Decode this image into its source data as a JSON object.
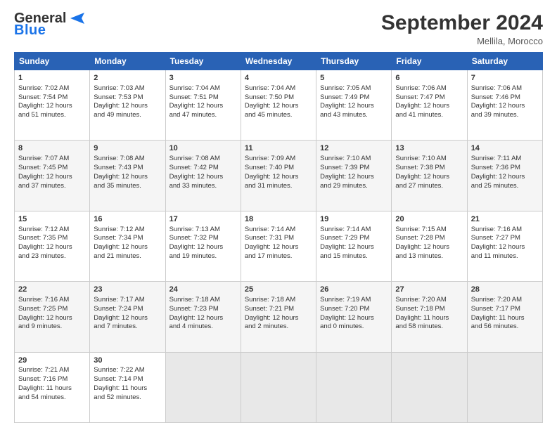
{
  "logo": {
    "line1": "General",
    "line2": "Blue"
  },
  "header": {
    "title": "September 2024",
    "location": "Mellila, Morocco"
  },
  "weekdays": [
    "Sunday",
    "Monday",
    "Tuesday",
    "Wednesday",
    "Thursday",
    "Friday",
    "Saturday"
  ],
  "weeks": [
    [
      {
        "day": 1,
        "sunrise": "7:02 AM",
        "sunset": "7:54 PM",
        "daylight": "12 hours and 51 minutes."
      },
      {
        "day": 2,
        "sunrise": "7:03 AM",
        "sunset": "7:53 PM",
        "daylight": "12 hours and 49 minutes."
      },
      {
        "day": 3,
        "sunrise": "7:04 AM",
        "sunset": "7:51 PM",
        "daylight": "12 hours and 47 minutes."
      },
      {
        "day": 4,
        "sunrise": "7:04 AM",
        "sunset": "7:50 PM",
        "daylight": "12 hours and 45 minutes."
      },
      {
        "day": 5,
        "sunrise": "7:05 AM",
        "sunset": "7:49 PM",
        "daylight": "12 hours and 43 minutes."
      },
      {
        "day": 6,
        "sunrise": "7:06 AM",
        "sunset": "7:47 PM",
        "daylight": "12 hours and 41 minutes."
      },
      {
        "day": 7,
        "sunrise": "7:06 AM",
        "sunset": "7:46 PM",
        "daylight": "12 hours and 39 minutes."
      }
    ],
    [
      {
        "day": 8,
        "sunrise": "7:07 AM",
        "sunset": "7:45 PM",
        "daylight": "12 hours and 37 minutes."
      },
      {
        "day": 9,
        "sunrise": "7:08 AM",
        "sunset": "7:43 PM",
        "daylight": "12 hours and 35 minutes."
      },
      {
        "day": 10,
        "sunrise": "7:08 AM",
        "sunset": "7:42 PM",
        "daylight": "12 hours and 33 minutes."
      },
      {
        "day": 11,
        "sunrise": "7:09 AM",
        "sunset": "7:40 PM",
        "daylight": "12 hours and 31 minutes."
      },
      {
        "day": 12,
        "sunrise": "7:10 AM",
        "sunset": "7:39 PM",
        "daylight": "12 hours and 29 minutes."
      },
      {
        "day": 13,
        "sunrise": "7:10 AM",
        "sunset": "7:38 PM",
        "daylight": "12 hours and 27 minutes."
      },
      {
        "day": 14,
        "sunrise": "7:11 AM",
        "sunset": "7:36 PM",
        "daylight": "12 hours and 25 minutes."
      }
    ],
    [
      {
        "day": 15,
        "sunrise": "7:12 AM",
        "sunset": "7:35 PM",
        "daylight": "12 hours and 23 minutes."
      },
      {
        "day": 16,
        "sunrise": "7:12 AM",
        "sunset": "7:34 PM",
        "daylight": "12 hours and 21 minutes."
      },
      {
        "day": 17,
        "sunrise": "7:13 AM",
        "sunset": "7:32 PM",
        "daylight": "12 hours and 19 minutes."
      },
      {
        "day": 18,
        "sunrise": "7:14 AM",
        "sunset": "7:31 PM",
        "daylight": "12 hours and 17 minutes."
      },
      {
        "day": 19,
        "sunrise": "7:14 AM",
        "sunset": "7:29 PM",
        "daylight": "12 hours and 15 minutes."
      },
      {
        "day": 20,
        "sunrise": "7:15 AM",
        "sunset": "7:28 PM",
        "daylight": "12 hours and 13 minutes."
      },
      {
        "day": 21,
        "sunrise": "7:16 AM",
        "sunset": "7:27 PM",
        "daylight": "12 hours and 11 minutes."
      }
    ],
    [
      {
        "day": 22,
        "sunrise": "7:16 AM",
        "sunset": "7:25 PM",
        "daylight": "12 hours and 9 minutes."
      },
      {
        "day": 23,
        "sunrise": "7:17 AM",
        "sunset": "7:24 PM",
        "daylight": "12 hours and 7 minutes."
      },
      {
        "day": 24,
        "sunrise": "7:18 AM",
        "sunset": "7:23 PM",
        "daylight": "12 hours and 4 minutes."
      },
      {
        "day": 25,
        "sunrise": "7:18 AM",
        "sunset": "7:21 PM",
        "daylight": "12 hours and 2 minutes."
      },
      {
        "day": 26,
        "sunrise": "7:19 AM",
        "sunset": "7:20 PM",
        "daylight": "12 hours and 0 minutes."
      },
      {
        "day": 27,
        "sunrise": "7:20 AM",
        "sunset": "7:18 PM",
        "daylight": "11 hours and 58 minutes."
      },
      {
        "day": 28,
        "sunrise": "7:20 AM",
        "sunset": "7:17 PM",
        "daylight": "11 hours and 56 minutes."
      }
    ],
    [
      {
        "day": 29,
        "sunrise": "7:21 AM",
        "sunset": "7:16 PM",
        "daylight": "11 hours and 54 minutes."
      },
      {
        "day": 30,
        "sunrise": "7:22 AM",
        "sunset": "7:14 PM",
        "daylight": "11 hours and 52 minutes."
      },
      null,
      null,
      null,
      null,
      null
    ]
  ]
}
